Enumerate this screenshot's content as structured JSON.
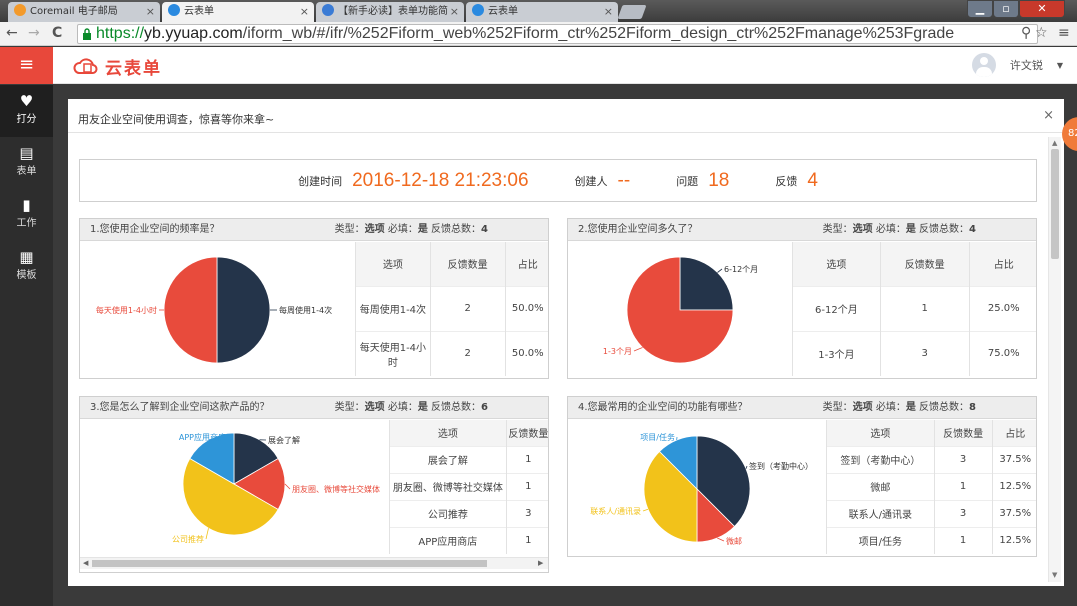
{
  "browser": {
    "tabs": [
      {
        "label": "Coremail 电子邮局",
        "color": "#f39a2b",
        "active": false
      },
      {
        "label": "云表单",
        "color": "#2a8ae0",
        "active": true
      },
      {
        "label": "【新手必读】表单功能简",
        "color": "#3a7bd5",
        "active": false
      },
      {
        "label": "云表单",
        "color": "#2a8ae0",
        "active": false
      }
    ],
    "url_scheme": "https://",
    "url_host": "yb.yyuap.com",
    "url_path": "/iform_wb/#/ifr/%252Fiform_web%252Fiform_ctr%252Fiform_design_ctr%252Fmanage%253Fgrade"
  },
  "header": {
    "logo_text": "云表单",
    "user_name": "许文锐",
    "brand_color": "#e8483b"
  },
  "sidebar": {
    "items": [
      {
        "label": "打分",
        "icon": "heart-icon",
        "active": true
      },
      {
        "label": "表单",
        "icon": "form-icon",
        "active": false
      },
      {
        "label": "工作",
        "icon": "briefcase-icon",
        "active": false
      },
      {
        "label": "模板",
        "icon": "template-icon",
        "active": false
      }
    ]
  },
  "dialog": {
    "title": "用友企业空间使用调查，惊喜等你来拿~",
    "close": "×",
    "badge": "82"
  },
  "summary": {
    "created_label": "创建时间",
    "created_value": "2016-12-18 21:23:06",
    "creator_label": "创建人",
    "creator_value": "--",
    "questions_label": "问题",
    "questions_value": "18",
    "feedback_label": "反馈",
    "feedback_value": "4"
  },
  "table_headers": {
    "option": "选项",
    "count": "反馈数量",
    "ratio": "占比"
  },
  "questions": [
    {
      "title": "1.您使用企业空间的频率是？",
      "type_label": "类型：",
      "type_value": "选项",
      "req_label": "必填：",
      "req_value": "是",
      "total_label": "反馈总数：",
      "total_value": "4",
      "rows": [
        {
          "option": "每周使用1-4次",
          "count": "2",
          "ratio": "50.0%"
        },
        {
          "option": "每天使用1-4小时",
          "count": "2",
          "ratio": "50.0%"
        }
      ]
    },
    {
      "title": "2.您使用企业空间多久了？",
      "type_label": "类型：",
      "type_value": "选项",
      "req_label": "必填：",
      "req_value": "是",
      "total_label": "反馈总数：",
      "total_value": "4",
      "rows": [
        {
          "option": "6-12个月",
          "count": "1",
          "ratio": "25.0%"
        },
        {
          "option": "1-3个月",
          "count": "3",
          "ratio": "75.0%"
        }
      ]
    },
    {
      "title": "3.您是怎么了解到企业空间这款产品的？",
      "type_label": "类型：",
      "type_value": "选项",
      "req_label": "必填：",
      "req_value": "是",
      "total_label": "反馈总数：",
      "total_value": "6",
      "rows": [
        {
          "option": "展会了解",
          "count": "1",
          "ratio": ""
        },
        {
          "option": "朋友圈、微博等社交媒体",
          "count": "1",
          "ratio": ""
        },
        {
          "option": "公司推荐",
          "count": "3",
          "ratio": ""
        },
        {
          "option": "APP应用商店",
          "count": "1",
          "ratio": ""
        }
      ]
    },
    {
      "title": "4.您最常用的企业空间的功能有哪些？",
      "type_label": "类型：",
      "type_value": "选项",
      "req_label": "必填：",
      "req_value": "是",
      "total_label": "反馈总数：",
      "total_value": "8",
      "rows": [
        {
          "option": "签到（考勤中心）",
          "count": "3",
          "ratio": "37.5%"
        },
        {
          "option": "微邮",
          "count": "1",
          "ratio": "12.5%"
        },
        {
          "option": "联系人/通讯录",
          "count": "3",
          "ratio": "37.5%"
        },
        {
          "option": "项目/任务",
          "count": "1",
          "ratio": "12.5%"
        }
      ]
    }
  ],
  "chart_data": [
    {
      "type": "pie",
      "title": "1.您使用企业空间的频率是？",
      "labels": [
        "每周使用1-4次",
        "每天使用1-4小时"
      ],
      "values": [
        2,
        2
      ],
      "colors": [
        "#24344a",
        "#e84b3c"
      ]
    },
    {
      "type": "pie",
      "title": "2.您使用企业空间多久了？",
      "labels": [
        "6-12个月",
        "1-3个月"
      ],
      "values": [
        1,
        3
      ],
      "colors": [
        "#24344a",
        "#e84b3c"
      ]
    },
    {
      "type": "pie",
      "title": "3.您是怎么了解到企业空间这款产品的？",
      "labels": [
        "展会了解",
        "朋友圈、微博等社交媒体",
        "公司推荐",
        "APP应用商店"
      ],
      "values": [
        1,
        1,
        3,
        1
      ],
      "label_texts": [
        "展会了解",
        "朋友圈、微博等社交媒体",
        "公司推荐",
        "APP应用商店"
      ],
      "colors": [
        "#24344a",
        "#e84b3c",
        "#f2c21a",
        "#2e95d8"
      ]
    },
    {
      "type": "pie",
      "title": "4.您最常用的企业空间的功能有哪些？",
      "labels": [
        "签到（考勤中心）",
        "微邮",
        "联系人/通讯录",
        "项目/任务"
      ],
      "values": [
        3,
        1,
        3,
        1
      ],
      "colors": [
        "#24344a",
        "#e84b3c",
        "#f2c21a",
        "#2e95d8"
      ]
    }
  ]
}
